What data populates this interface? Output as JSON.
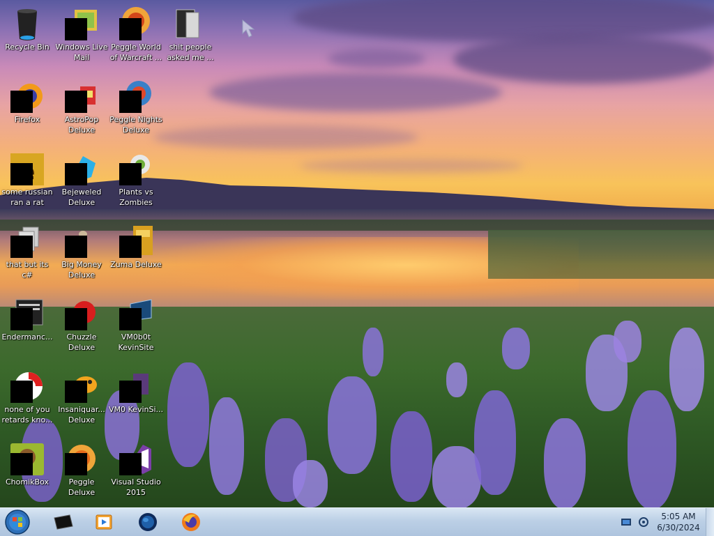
{
  "desktop": {
    "icons": [
      {
        "id": "recycle-bin",
        "label": "Recycle Bin",
        "icon": "recycle-bin-icon"
      },
      {
        "id": "windows-live-mail",
        "label": "Windows Live Mail",
        "icon": "mail-icon"
      },
      {
        "id": "peggle-world-of-warcraft",
        "label": "Peggle World of Warcraft ...",
        "icon": "peggle-icon"
      },
      {
        "id": "shit-people",
        "label": "shit people asked me ...",
        "icon": "folder-icon"
      },
      {
        "id": "firefox",
        "label": "Firefox",
        "icon": "firefox-icon"
      },
      {
        "id": "astropop",
        "label": "AstroPop Deluxe",
        "icon": "astropop-icon"
      },
      {
        "id": "peggle-nights",
        "label": "Peggle Nights Deluxe",
        "icon": "peggle-icon"
      },
      {
        "id": "russian-rat",
        "label": "some russian ran a rat",
        "icon": "app-icon"
      },
      {
        "id": "bejeweled",
        "label": "Bejeweled Deluxe",
        "icon": "gem-icon"
      },
      {
        "id": "plants-vs-zombies",
        "label": "Plants vs Zombies",
        "icon": "plant-icon"
      },
      {
        "id": "that-but-c-sharp",
        "label": "that but its c#",
        "icon": "stack-icon"
      },
      {
        "id": "big-money",
        "label": "Big Money Deluxe",
        "icon": "money-bag-icon"
      },
      {
        "id": "zuma",
        "label": "Zuma Deluxe",
        "icon": "zuma-icon"
      },
      {
        "id": "endermanch",
        "label": "Endermanc...",
        "icon": "console-icon"
      },
      {
        "id": "chuzzle",
        "label": "Chuzzle Deluxe",
        "icon": "chuzzle-icon"
      },
      {
        "id": "vm0b0t-kevinsite",
        "label": "VM0b0t KevinSite",
        "icon": "monitor-icon"
      },
      {
        "id": "none-of-you",
        "label": "none of you retards kno...",
        "icon": "disc-icon"
      },
      {
        "id": "insaniquarium",
        "label": "Insaniquar... Deluxe",
        "icon": "fish-icon"
      },
      {
        "id": "vm0-kevinsi",
        "label": "VM0 KevinSi...",
        "icon": "vm-icon"
      },
      {
        "id": "chomikbox",
        "label": "ChomikBox",
        "icon": "hamster-icon"
      },
      {
        "id": "peggle-deluxe",
        "label": "Peggle Deluxe",
        "icon": "peggle-icon"
      },
      {
        "id": "visual-studio-2015",
        "label": "Visual Studio 2015",
        "icon": "visual-studio-icon"
      }
    ]
  },
  "taskbar": {
    "start_icon": "windows-orb-icon",
    "pinned": [
      {
        "id": "pinned-app-1",
        "icon": "black-box-icon"
      },
      {
        "id": "pinned-app-2",
        "icon": "media-player-icon"
      },
      {
        "id": "pinned-app-3",
        "icon": "globe-icon"
      },
      {
        "id": "pinned-app-4",
        "icon": "firefox-icon"
      }
    ],
    "tray": {
      "icons": [
        "network-icon",
        "volume-icon"
      ],
      "time": "5:05 AM",
      "date": "6/30/2024"
    }
  },
  "colors": {
    "label_text": "#ffffff",
    "taskbar": "#bcd0e6",
    "clock_text": "#1b2a3e",
    "redaction": "#000000"
  }
}
